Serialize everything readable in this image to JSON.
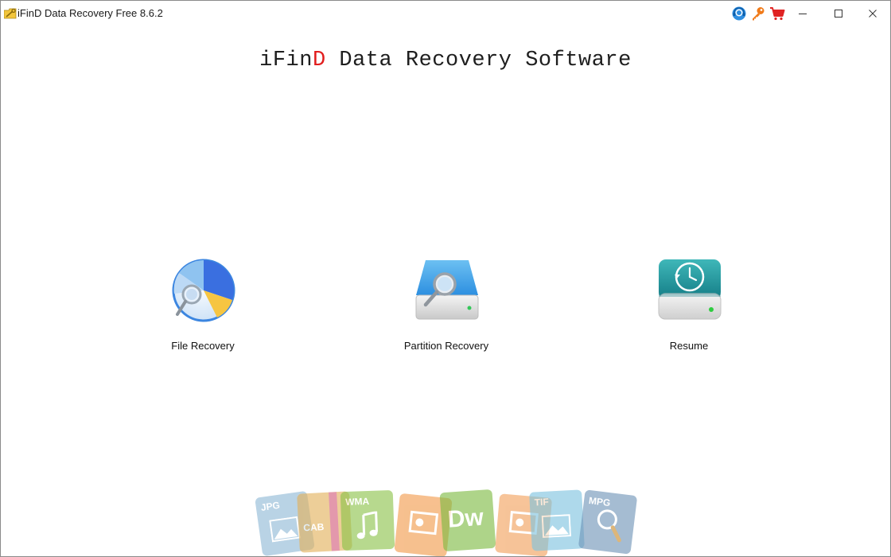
{
  "window": {
    "title": "iFinD Data Recovery Free 8.6.2",
    "app_icon": "folder-key-icon"
  },
  "titlebar_icons": [
    {
      "name": "support-chat-icon"
    },
    {
      "name": "register-key-icon"
    },
    {
      "name": "buy-cart-icon"
    }
  ],
  "window_controls": {
    "minimize": "minimize-icon",
    "maximize": "maximize-icon",
    "close": "close-icon"
  },
  "heading": {
    "part1": "iFin",
    "part2": "D",
    "part3": " Data Recovery Software",
    "accent_color": "#e11d1d"
  },
  "features": [
    {
      "label": "File Recovery",
      "icon": "file-recovery-pie-icon"
    },
    {
      "label": "Partition Recovery",
      "icon": "partition-drive-icon"
    },
    {
      "label": "Resume",
      "icon": "resume-clock-drive-icon"
    }
  ],
  "file_types": [
    {
      "label": "JPG",
      "color": "#8fb9d6"
    },
    {
      "label": "CAB",
      "color": "#e3b15a"
    },
    {
      "label": "WMA",
      "color": "#8cc34a"
    },
    {
      "label": "",
      "color": "#f29a4a"
    },
    {
      "label": "Dw",
      "color": "#7dbb42"
    },
    {
      "label": "",
      "color": "#f2a05a"
    },
    {
      "label": "TIF",
      "color": "#7ec3df"
    },
    {
      "label": "MPG",
      "color": "#6f94b8"
    }
  ]
}
